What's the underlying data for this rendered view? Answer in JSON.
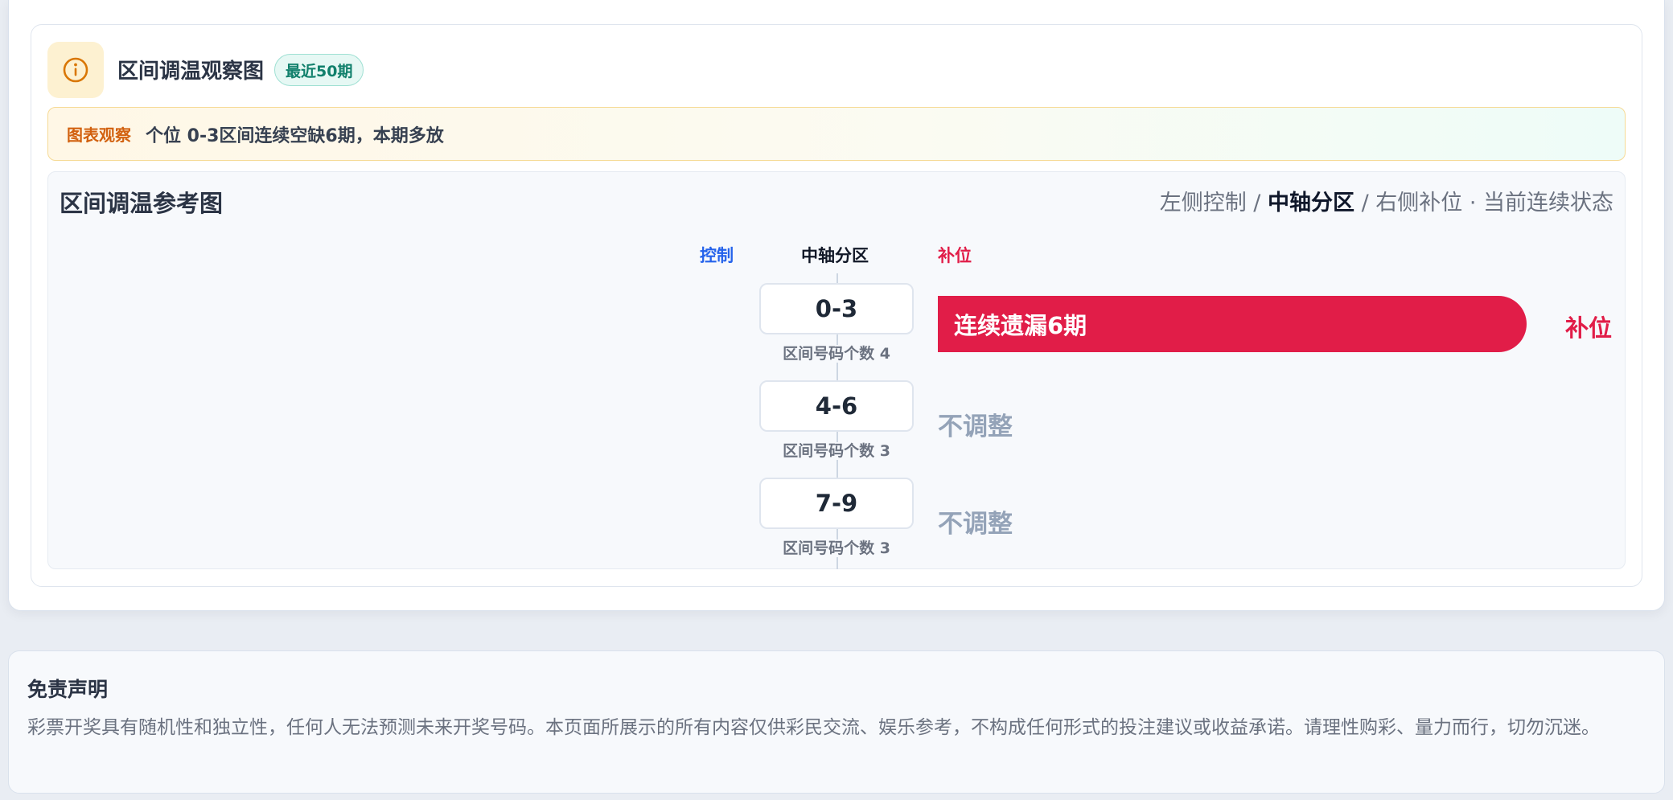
{
  "header": {
    "title": "区间调温观察图",
    "period_tag": "最近50期"
  },
  "observation": {
    "label": "图表观察",
    "text": "个位 0-3区间连续空缺6期，本期多放"
  },
  "chart": {
    "title": "区间调温参考图",
    "legend": {
      "left": "左侧控制",
      "sep1": " / ",
      "center": "中轴分区",
      "sep2": " / ",
      "right": "右侧补位",
      "dot": " · ",
      "state": "当前连续状态"
    },
    "columns": {
      "control": "控制",
      "center": "中轴分区",
      "supplement": "补位"
    },
    "zones": [
      {
        "range": "0-3",
        "count_label": "区间号码个数 4",
        "state": "supplement",
        "bar_label": "连续遗漏6期",
        "end_label": "补位",
        "missing_periods": 6
      },
      {
        "range": "4-6",
        "count_label": "区间号码个数 3",
        "state": "none",
        "status_label": "不调整"
      },
      {
        "range": "7-9",
        "count_label": "区间号码个数 3",
        "state": "none",
        "status_label": "不调整"
      }
    ],
    "colors": {
      "control": "#2563eb",
      "supplement": "#e11d48",
      "neutral": "#94a3b8"
    }
  },
  "disclaimer": {
    "title": "免责声明",
    "text": "彩票开奖具有随机性和独立性，任何人无法预测未来开奖号码。本页面所展示的所有内容仅供彩民交流、娱乐参考，不构成任何形式的投注建议或收益承诺。请理性购彩、量力而行，切勿沉迷。"
  }
}
